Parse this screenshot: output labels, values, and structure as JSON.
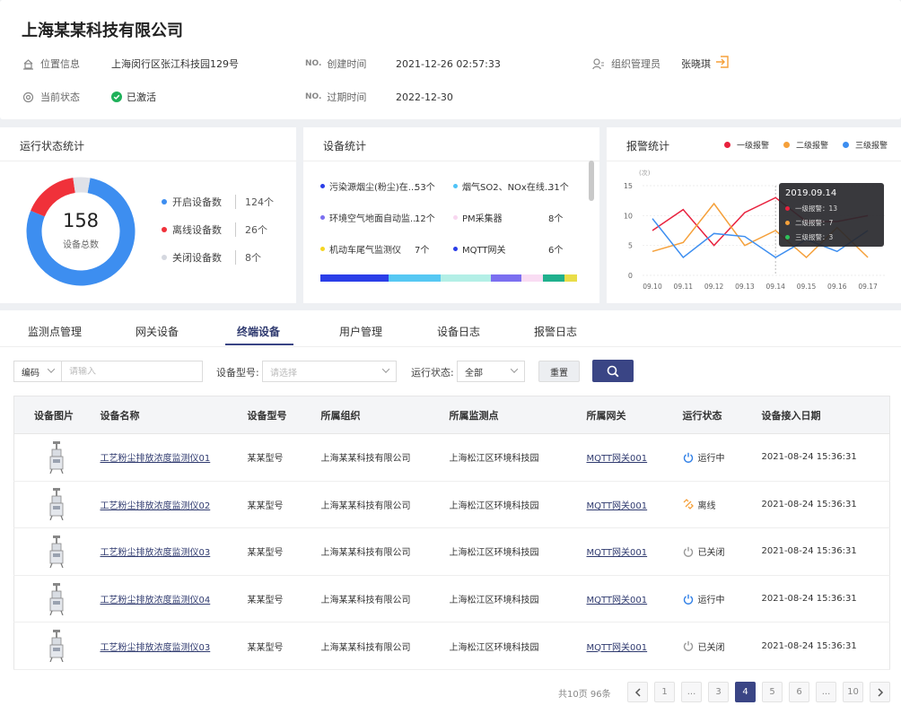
{
  "header": {
    "company": "上海某某科技有限公司",
    "location_label": "位置信息",
    "location_value": "上海闵行区张江科技园129号",
    "status_label": "当前状态",
    "status_value": "已激活",
    "created_prefix": "NO.",
    "created_label": "创建时间",
    "created_value": "2021-12-26 02:57:33",
    "expire_prefix": "NO.",
    "expire_label": "过期时间",
    "expire_value": "2022-12-30",
    "admin_label": "组织管理员",
    "admin_value": "张晓琪"
  },
  "run_stats": {
    "title": "运行状态统计",
    "total": "158",
    "total_label": "设备总数",
    "items": [
      {
        "label": "开启设备数",
        "count": "124个",
        "value": 124,
        "color": "#3d8ef0"
      },
      {
        "label": "离线设备数",
        "count": "26个",
        "value": 26,
        "color": "#f0313a"
      },
      {
        "label": "关闭设备数",
        "count": "8个",
        "value": 8,
        "color": "#dfe1e8"
      }
    ]
  },
  "device_stats": {
    "title": "设备统计",
    "items": [
      {
        "label": "污染源烟尘(粉尘)在...",
        "count": "53个",
        "color": "#2b3ee8"
      },
      {
        "label": "烟气SO2、NOx在线...",
        "count": "31个",
        "color": "#4fc3f7"
      },
      {
        "label": "环境空气地面自动监...",
        "count": "12个",
        "color": "#7b6ff0"
      },
      {
        "label": "PM采集器",
        "count": "8个",
        "color": "#f8d7f0"
      },
      {
        "label": "机动车尾气监测仪",
        "count": "7个",
        "color": "#f5d623"
      },
      {
        "label": "MQTT网关",
        "count": "6个",
        "color": "#2b3ee8"
      }
    ],
    "bar_segments": [
      {
        "value": 0.22,
        "color": "#2b3ee8"
      },
      {
        "value": 0.17,
        "color": "#56c8f3"
      },
      {
        "value": 0.16,
        "color": "#b3efe6"
      },
      {
        "value": 0.1,
        "color": "#7b6ff0"
      },
      {
        "value": 0.07,
        "color": "#f9dcf3"
      },
      {
        "value": 0.07,
        "color": "#20b08d"
      },
      {
        "value": 0.04,
        "color": "#e9dd48"
      }
    ]
  },
  "alarm_stats": {
    "title": "报警统计",
    "legend": [
      {
        "label": "一级报警",
        "color": "#e8213d"
      },
      {
        "label": "二级报警",
        "color": "#f5a03a"
      },
      {
        "label": "三级报警",
        "color": "#3d8ef0"
      }
    ],
    "tooltip": {
      "date": "2019.09.14",
      "rows": [
        {
          "label": "一级报警：13",
          "color": "#e8213d"
        },
        {
          "label": "二级报警：7",
          "color": "#f5a03a"
        },
        {
          "label": "三级报警：3",
          "color": "#2ec25b"
        }
      ]
    }
  },
  "chart_data": {
    "type": "line",
    "ylabel": "(次)",
    "ylim": [
      0,
      15
    ],
    "yticks": [
      "0",
      "5",
      "10",
      "15"
    ],
    "categories": [
      "09.10",
      "09.11",
      "09.12",
      "09.13",
      "09.14",
      "09.15",
      "09.16",
      "09.17"
    ],
    "series": [
      {
        "name": "一级报警",
        "color": "#e8213d",
        "values": [
          7.5,
          11,
          5,
          10.5,
          13,
          9,
          9,
          10
        ]
      },
      {
        "name": "二级报警",
        "color": "#f5a03a",
        "values": [
          4,
          5.5,
          12,
          5,
          7.5,
          3,
          8,
          3
        ]
      },
      {
        "name": "三级报警",
        "color": "#3d8ef0",
        "values": [
          9.5,
          3,
          7,
          6.5,
          3,
          6,
          4,
          7.5
        ]
      }
    ]
  },
  "tabs": [
    "监测点管理",
    "网关设备",
    "终端设备",
    "用户管理",
    "设备日志",
    "报警日志"
  ],
  "filters": {
    "code_select": "编码",
    "code_placeholder": "请输入",
    "type_label": "设备型号:",
    "type_placeholder": "请选择",
    "status_label": "运行状态:",
    "status_value": "全部",
    "reset": "重置"
  },
  "table": {
    "headers": [
      "设备图片",
      "设备名称",
      "设备型号",
      "所属组织",
      "所属监测点",
      "所属网关",
      "运行状态",
      "设备接入日期"
    ],
    "rows": [
      {
        "name": "工艺粉尘排放浓度监测仪01",
        "model": "某某型号",
        "org": "上海某某科技有限公司",
        "site": "上海松江区环境科技园",
        "gateway": "MQTT网关001",
        "status": "运行中",
        "status_kind": "running",
        "date": "2021-08-24 15:36:31"
      },
      {
        "name": "工艺粉尘排放浓度监测仪02",
        "model": "某某型号",
        "org": "上海某某科技有限公司",
        "site": "上海松江区环境科技园",
        "gateway": "MQTT网关001",
        "status": "离线",
        "status_kind": "offline",
        "date": "2021-08-24 15:36:31"
      },
      {
        "name": "工艺粉尘排放浓度监测仪03",
        "model": "某某型号",
        "org": "上海某某科技有限公司",
        "site": "上海松江区环境科技园",
        "gateway": "MQTT网关001",
        "status": "已关闭",
        "status_kind": "closed",
        "date": "2021-08-24 15:36:31"
      },
      {
        "name": "工艺粉尘排放浓度监测仪04",
        "model": "某某型号",
        "org": "上海某某科技有限公司",
        "site": "上海松江区环境科技园",
        "gateway": "MQTT网关001",
        "status": "运行中",
        "status_kind": "running",
        "date": "2021-08-24 15:36:31"
      },
      {
        "name": "工艺粉尘排放浓度监测仪03",
        "model": "某某型号",
        "org": "上海某某科技有限公司",
        "site": "上海松江区环境科技园",
        "gateway": "MQTT网关001",
        "status": "已关闭",
        "status_kind": "closed",
        "date": "2021-08-24 15:36:31"
      }
    ]
  },
  "pagination": {
    "total": "共10页  96条",
    "pages": [
      "1",
      "...",
      "3",
      "4",
      "5",
      "6",
      "...",
      "10"
    ],
    "current": "4"
  },
  "colors": {
    "primary": "#3a4585",
    "running": "#2f7fe6",
    "offline": "#f5a03a",
    "closed": "#999999"
  }
}
